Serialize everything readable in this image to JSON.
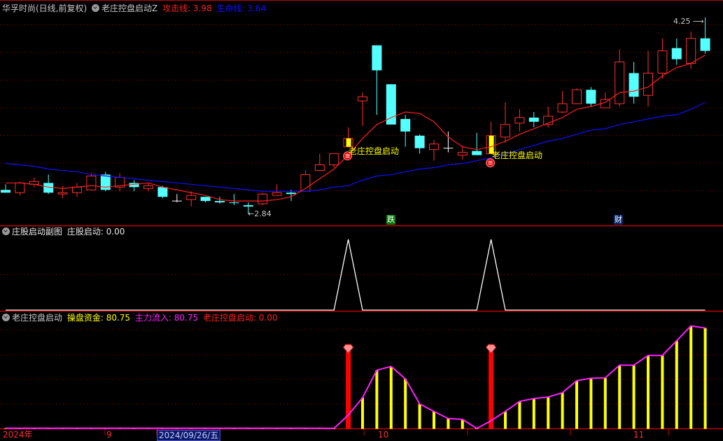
{
  "header": {
    "stock": "华孚时尚(日线,前复权)",
    "indicator": "老庄控盘启动Z",
    "attack_label": "攻击线: 3.98",
    "life_label": "生命线: 3.64"
  },
  "sub_panel": {
    "title": "庄股启动副图",
    "value_label": "庄股启动: 0.00"
  },
  "bottom_panel": {
    "title": "老庄控盘启动",
    "fund_label": "操盘资金: 80.75",
    "inflow_label": "主力流入: 80.75",
    "start_label": "老庄控盘启动: 0.00"
  },
  "annotations": {
    "high": "4.25",
    "low": "2.84",
    "signal_text": "老庄控盘启动",
    "tag_die": "跌",
    "tag_cai": "财"
  },
  "x_axis": {
    "year": "2024年",
    "sep": "9",
    "cursor_date": "2024/09/26/五",
    "oct": "10",
    "nov": "11"
  },
  "colors": {
    "up": "#ff3030",
    "down": "#54ffff",
    "attack": "#ff2020",
    "life": "#1010ff",
    "fund": "#ffff00",
    "inflow": "#ff20ff",
    "signal": "#ff0000"
  },
  "chart_data": {
    "type": "candlestick",
    "title": "华孚时尚 日线",
    "price_range": [
      2.84,
      4.25
    ],
    "ohlc": [
      [
        3.01,
        3.05,
        2.99,
        2.99
      ],
      [
        2.99,
        3.07,
        2.97,
        3.06
      ],
      [
        3.05,
        3.1,
        3.03,
        3.07
      ],
      [
        3.06,
        3.12,
        2.98,
        2.99
      ],
      [
        2.98,
        3.04,
        2.95,
        2.99
      ],
      [
        2.99,
        3.06,
        2.96,
        3.03
      ],
      [
        3.01,
        3.13,
        3.01,
        3.11
      ],
      [
        3.12,
        3.14,
        3.0,
        3.01
      ],
      [
        3.03,
        3.13,
        3.0,
        3.1
      ],
      [
        3.06,
        3.08,
        3.0,
        3.03
      ],
      [
        3.02,
        3.06,
        3.0,
        3.04
      ],
      [
        3.03,
        3.04,
        2.95,
        2.96
      ],
      [
        2.93,
        2.98,
        2.92,
        2.93
      ],
      [
        2.94,
        3.0,
        2.89,
        2.97
      ],
      [
        2.96,
        2.96,
        2.92,
        2.93
      ],
      [
        2.93,
        2.96,
        2.91,
        2.92
      ],
      [
        2.92,
        2.98,
        2.9,
        2.915
      ],
      [
        2.9,
        2.92,
        2.84,
        2.89
      ],
      [
        2.91,
        2.99,
        2.9,
        2.98
      ],
      [
        2.97,
        3.05,
        2.97,
        2.99
      ],
      [
        2.99,
        3.01,
        2.93,
        2.98
      ],
      [
        3.0,
        3.15,
        3.0,
        3.12
      ],
      [
        3.15,
        3.27,
        3.15,
        3.19
      ],
      [
        3.19,
        3.27,
        3.17,
        3.27
      ],
      [
        3.32,
        3.46,
        3.32,
        3.38
      ],
      [
        3.65,
        3.71,
        3.47,
        3.68
      ],
      [
        4.05,
        4.05,
        3.55,
        3.87
      ],
      [
        3.77,
        3.77,
        3.48,
        3.48
      ],
      [
        3.52,
        3.55,
        3.32,
        3.43
      ],
      [
        3.4,
        3.41,
        3.27,
        3.31
      ],
      [
        3.3,
        3.37,
        3.22,
        3.34
      ],
      [
        3.31,
        3.43,
        3.28,
        3.31
      ],
      [
        3.26,
        3.33,
        3.23,
        3.28
      ],
      [
        3.29,
        3.42,
        3.26,
        3.26
      ],
      [
        3.27,
        3.5,
        3.27,
        3.4
      ],
      [
        3.39,
        3.64,
        3.35,
        3.48
      ],
      [
        3.49,
        3.59,
        3.43,
        3.53
      ],
      [
        3.53,
        3.57,
        3.46,
        3.5
      ],
      [
        3.48,
        3.61,
        3.46,
        3.54
      ],
      [
        3.57,
        3.72,
        3.56,
        3.63
      ],
      [
        3.63,
        3.74,
        3.63,
        3.73
      ],
      [
        3.73,
        3.75,
        3.61,
        3.63
      ],
      [
        3.6,
        3.71,
        3.6,
        3.66
      ],
      [
        3.63,
        4.02,
        3.61,
        3.93
      ],
      [
        3.85,
        3.93,
        3.63,
        3.68
      ],
      [
        3.69,
        4.01,
        3.61,
        3.85
      ],
      [
        3.85,
        4.1,
        3.81,
        4.01
      ],
      [
        4.03,
        4.1,
        3.91,
        3.95
      ],
      [
        3.92,
        4.15,
        3.88,
        4.1
      ],
      [
        4.1,
        4.25,
        3.99,
        4.01
      ]
    ],
    "signal_candles": [
      24,
      34
    ],
    "attack_line": [
      3.06,
      3.06,
      3.05,
      3.03,
      3.02,
      3.03,
      3.04,
      3.03,
      3.04,
      3.05,
      3.06,
      3.03,
      3.01,
      2.99,
      2.97,
      2.94,
      2.93,
      2.93,
      2.93,
      2.94,
      2.96,
      3.02,
      3.09,
      3.16,
      3.26,
      3.38,
      3.48,
      3.53,
      3.57,
      3.56,
      3.5,
      3.39,
      3.32,
      3.3,
      3.32,
      3.36,
      3.41,
      3.45,
      3.49,
      3.53,
      3.59,
      3.61,
      3.64,
      3.71,
      3.72,
      3.75,
      3.83,
      3.89,
      3.92,
      3.98
    ],
    "life_line": [
      3.2,
      3.19,
      3.18,
      3.16,
      3.15,
      3.14,
      3.12,
      3.11,
      3.1,
      3.09,
      3.08,
      3.07,
      3.06,
      3.05,
      3.04,
      3.03,
      3.02,
      3.01,
      3.0,
      3.0,
      3.0,
      3.0,
      3.01,
      3.03,
      3.04,
      3.08,
      3.11,
      3.12,
      3.14,
      3.16,
      3.17,
      3.19,
      3.2,
      3.22,
      3.24,
      3.27,
      3.3,
      3.33,
      3.36,
      3.38,
      3.41,
      3.44,
      3.45,
      3.48,
      3.5,
      3.52,
      3.54,
      3.55,
      3.59,
      3.64
    ],
    "sub_signal": [
      0,
      0,
      0,
      0,
      0,
      0,
      0,
      0,
      0,
      0,
      0,
      0,
      0,
      0,
      0,
      0,
      0,
      0,
      0,
      0,
      0,
      0,
      0,
      0,
      1,
      0,
      0,
      0,
      0,
      0,
      0,
      0,
      0,
      0,
      1,
      0,
      0,
      0,
      0,
      0,
      0,
      0,
      0,
      0,
      0,
      0,
      0,
      0,
      0,
      0
    ],
    "fund": [
      0.5,
      0.5,
      0.5,
      0.5,
      0.5,
      0.5,
      0.5,
      0.5,
      0.5,
      0.5,
      0.5,
      0.5,
      0.5,
      0.5,
      0.5,
      0.5,
      0.5,
      0.5,
      0.5,
      0.5,
      0.5,
      0.5,
      0.5,
      0.4,
      11,
      25,
      47,
      50,
      40,
      20,
      14,
      8.3,
      7.6,
      0.4,
      6.5,
      14,
      22,
      24.3,
      25.5,
      29,
      38.6,
      40.5,
      40.9,
      51,
      51,
      58.8,
      58.8,
      70.6,
      82.4,
      80.75
    ],
    "start_bar_value": 68,
    "fund_range": [
      0,
      90
    ]
  }
}
